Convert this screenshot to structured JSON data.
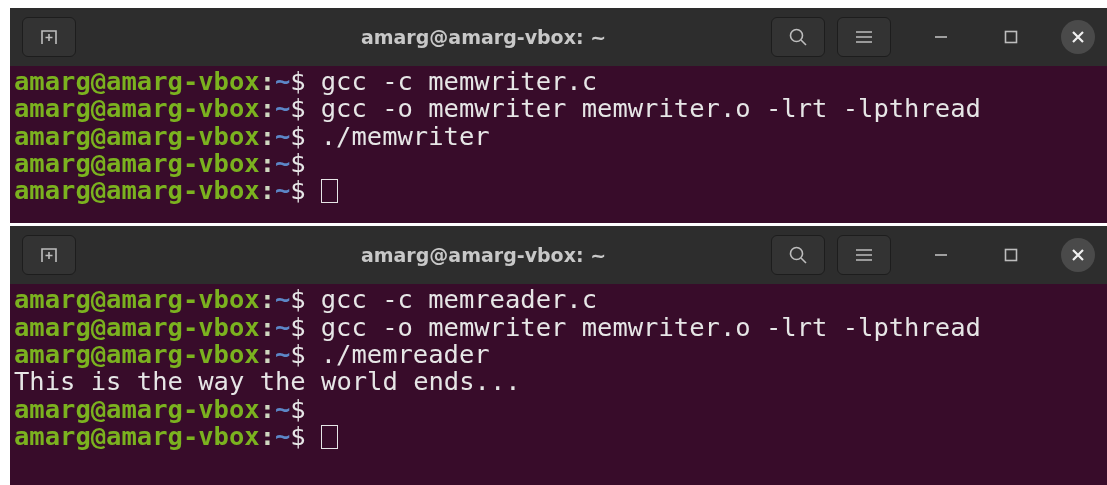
{
  "windows": [
    {
      "title": "amarg@amarg-vbox: ~",
      "lines": [
        {
          "kind": "prompt",
          "user_host": "amarg@amarg-vbox",
          "separator": ":",
          "path": "~",
          "symbol": "$",
          "command": "gcc -c memwriter.c",
          "cursor": false
        },
        {
          "kind": "prompt",
          "user_host": "amarg@amarg-vbox",
          "separator": ":",
          "path": "~",
          "symbol": "$",
          "command": "gcc -o memwriter memwriter.o -lrt -lpthread",
          "cursor": false
        },
        {
          "kind": "prompt",
          "user_host": "amarg@amarg-vbox",
          "separator": ":",
          "path": "~",
          "symbol": "$",
          "command": "./memwriter",
          "cursor": false
        },
        {
          "kind": "prompt",
          "user_host": "amarg@amarg-vbox",
          "separator": ":",
          "path": "~",
          "symbol": "$",
          "cursor": false
        },
        {
          "kind": "prompt",
          "user_host": "amarg@amarg-vbox",
          "separator": ":",
          "path": "~",
          "symbol": "$",
          "cursor": true
        }
      ]
    },
    {
      "title": "amarg@amarg-vbox: ~",
      "lines": [
        {
          "kind": "prompt",
          "user_host": "amarg@amarg-vbox",
          "separator": ":",
          "path": "~",
          "symbol": "$",
          "command": "gcc -c memreader.c",
          "cursor": false
        },
        {
          "kind": "prompt",
          "user_host": "amarg@amarg-vbox",
          "separator": ":",
          "path": "~",
          "symbol": "$",
          "command": "gcc -o memwriter memwriter.o -lrt -lpthread",
          "cursor": false
        },
        {
          "kind": "prompt",
          "user_host": "amarg@amarg-vbox",
          "separator": ":",
          "path": "~",
          "symbol": "$",
          "command": "./memreader",
          "cursor": false
        },
        {
          "kind": "output",
          "text": "This is the way the world ends..."
        },
        {
          "kind": "prompt",
          "user_host": "amarg@amarg-vbox",
          "separator": ":",
          "path": "~",
          "symbol": "$",
          "cursor": false
        },
        {
          "kind": "prompt",
          "user_host": "amarg@amarg-vbox",
          "separator": ":",
          "path": "~",
          "symbol": "$",
          "cursor": true
        }
      ]
    }
  ]
}
